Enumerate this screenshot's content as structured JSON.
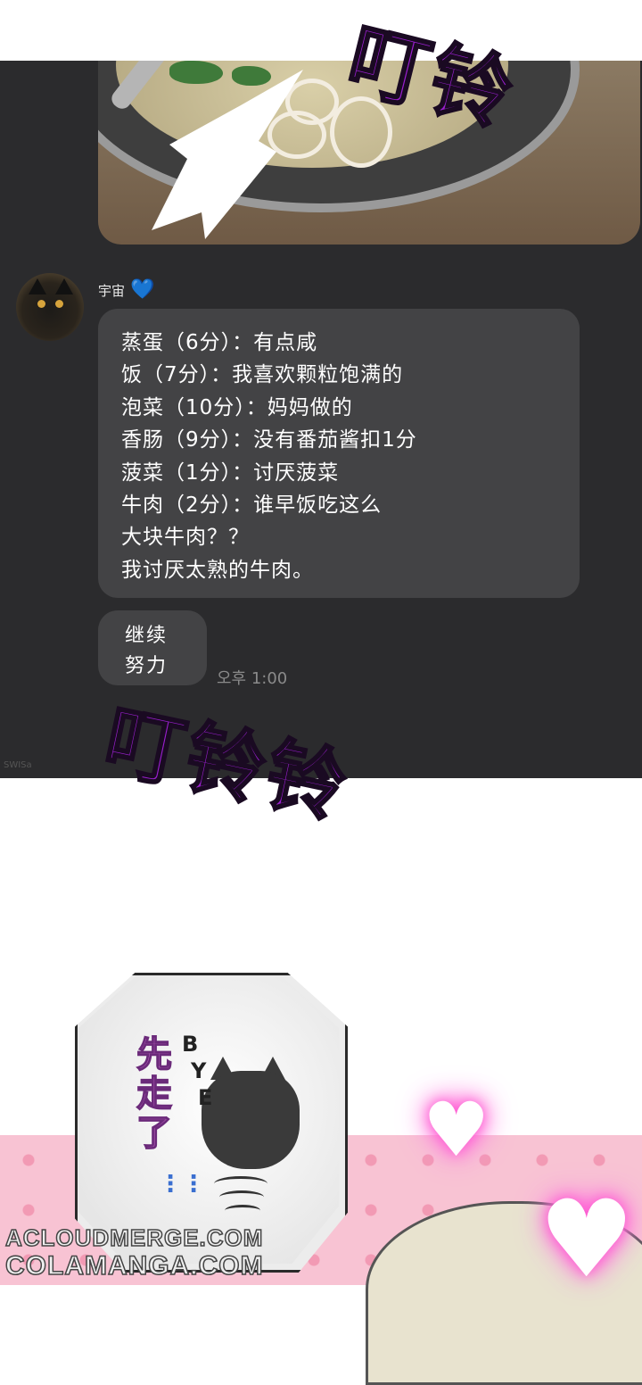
{
  "sfx": {
    "top": "叮铃",
    "middle": "叮铃铃"
  },
  "chat": {
    "sender_name": "宇宙",
    "sender_emoji": "💙",
    "message_lines": [
      "蒸蛋（6分）：有点咸",
      "饭（7分）：我喜欢颗粒饱满的",
      "泡菜（10分）：妈妈做的",
      "香肠（9分）：没有番茄酱扣1分",
      "菠菜（1分）：讨厌菠菜",
      "牛肉（2分）：谁早饭吃这么",
      "大块牛肉？？",
      "我讨厌太熟的牛肉。"
    ],
    "reply_lines": [
      "继续",
      "努力"
    ],
    "timestamp": "오후 1:00",
    "signature": "SWISa"
  },
  "bottom_panel": {
    "gone_text": "先走了",
    "bye_letters": [
      "B",
      "Y",
      "E"
    ],
    "dots": "⋮⋮"
  },
  "watermarks": {
    "line1": "ACLOUDMERGE.COM",
    "line2": "COLAMANGA.COM"
  },
  "colors": {
    "chat_background": "#2b2b2d",
    "bubble": "#434345",
    "sfx_purple": "#9b1fd0",
    "pink_background": "#f8c3d3"
  }
}
